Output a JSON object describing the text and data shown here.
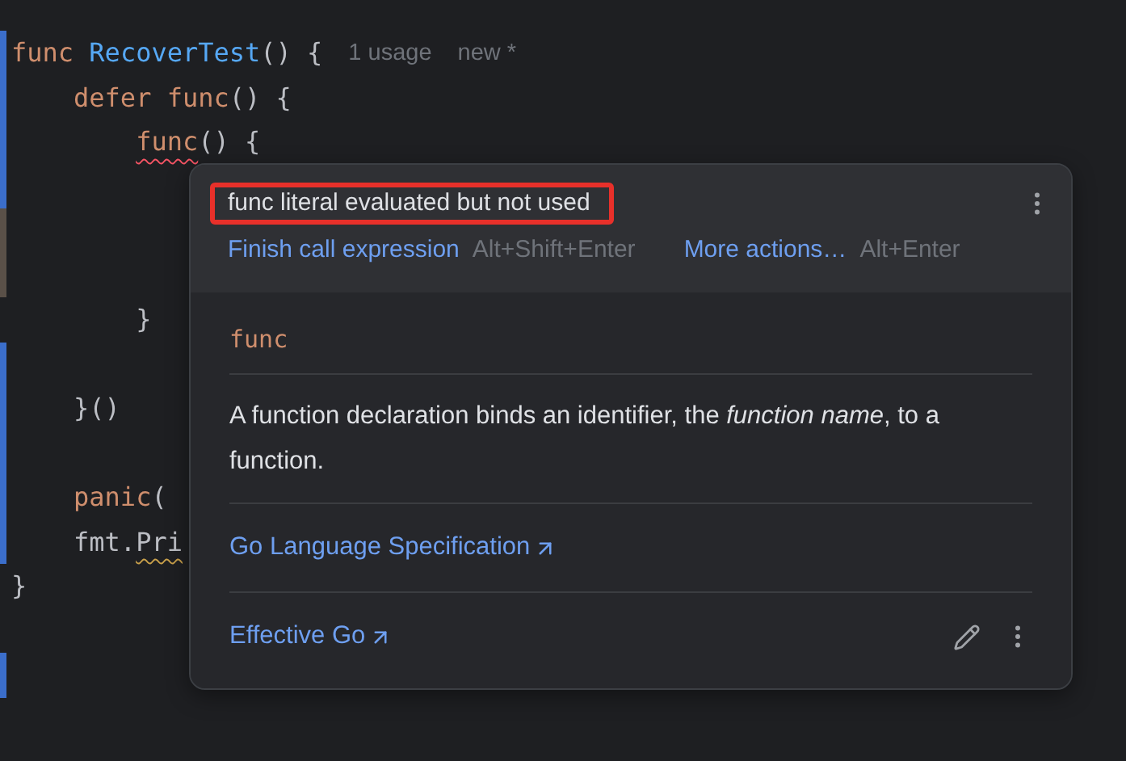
{
  "editor": {
    "lines": [
      {
        "kind": "code",
        "color": "#3b6ecb",
        "tokens": [
          {
            "text": "func ",
            "kind": "keyword"
          },
          {
            "text": "RecoverTest",
            "kind": "function"
          },
          {
            "text": "() {",
            "kind": "plain"
          },
          {
            "text": "1 usage",
            "kind": "hint"
          },
          {
            "text": "new *",
            "kind": "hint"
          }
        ]
      },
      {
        "kind": "code",
        "color": "#3b6ecb",
        "tokens": [
          {
            "text": "    defer func",
            "kind": "keyword"
          },
          {
            "text": "() {",
            "kind": "plain"
          }
        ]
      },
      {
        "kind": "code",
        "color": "#3b6ecb",
        "tokens": [
          {
            "text": "        func",
            "kind": "keyword",
            "error": true
          },
          {
            "text": "() {",
            "kind": "plain"
          }
        ]
      },
      {
        "kind": "blank",
        "color": "#3b6ecb"
      },
      {
        "kind": "blank",
        "color": "#5a5048"
      },
      {
        "kind": "blank",
        "color": "#5a5048"
      },
      {
        "kind": "code",
        "tokens": [
          {
            "text": "        }",
            "kind": "plain"
          }
        ]
      },
      {
        "kind": "blank",
        "color": "#3b6ecb"
      },
      {
        "kind": "code",
        "color": "#3b6ecb",
        "tokens": [
          {
            "text": "    }()",
            "kind": "plain"
          }
        ]
      },
      {
        "kind": "blank",
        "color": "#3b6ecb"
      },
      {
        "kind": "code",
        "color": "#3b6ecb",
        "tokens": [
          {
            "text": "    panic",
            "kind": "keyword"
          },
          {
            "text": "(",
            "kind": "plain"
          }
        ]
      },
      {
        "kind": "code",
        "color": "#3b6ecb",
        "tokens": [
          {
            "text": "    fmt.",
            "kind": "plain"
          },
          {
            "text": "Pri",
            "kind": "plain",
            "warning": true
          }
        ]
      },
      {
        "kind": "code",
        "tokens": [
          {
            "text": "}",
            "kind": "plain"
          }
        ]
      },
      {
        "kind": "blank"
      },
      {
        "kind": "blank",
        "color": "#3b6ecb"
      }
    ]
  },
  "popup": {
    "problem": "func literal evaluated but not used",
    "actions": [
      {
        "label": "Finish call expression",
        "shortcut": "Alt+Shift+Enter"
      },
      {
        "label": "More actions…",
        "shortcut": "Alt+Enter"
      }
    ],
    "keyword": "func",
    "description": "A function declaration binds an identifier, the *function name*, to a function.",
    "links": [
      "Go Language Specification",
      "Effective Go"
    ]
  }
}
